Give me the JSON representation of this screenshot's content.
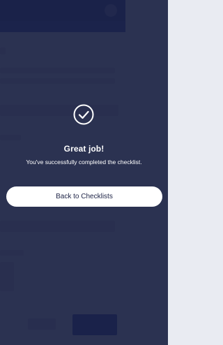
{
  "modal": {
    "icon": "checkmark-circle-icon",
    "title": "Great job!",
    "message": "You've successfully completed the checklist.",
    "back_button_label": "Back to Checklists"
  },
  "colors": {
    "overlay": "#1a2142",
    "button_bg": "#ffffff",
    "button_text": "#1d2346",
    "text": "#ffffff"
  }
}
